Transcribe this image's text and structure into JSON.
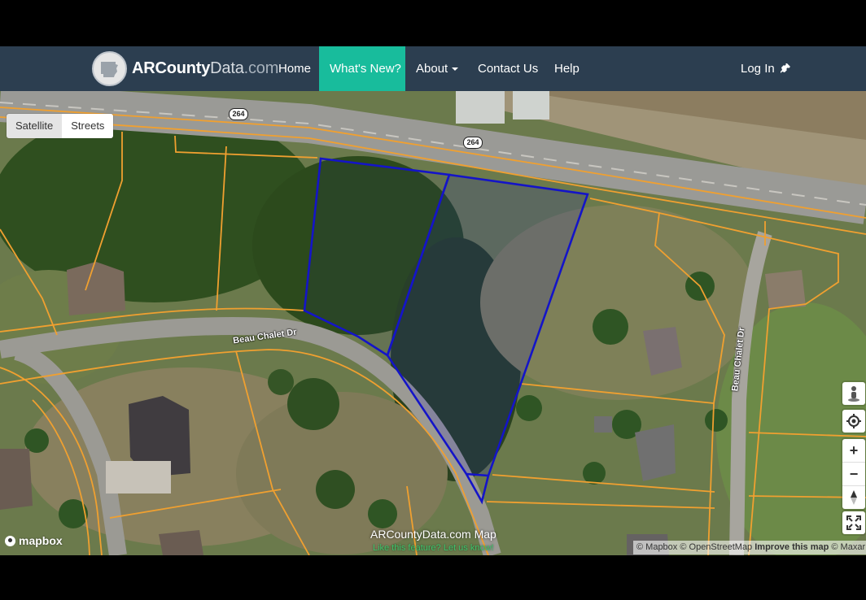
{
  "navbar": {
    "brand": {
      "part1": "ARCounty",
      "part2": "Data",
      "part3": ".com"
    },
    "items": [
      {
        "label": "Home"
      },
      {
        "label": "What's New?"
      },
      {
        "label": "About"
      },
      {
        "label": "Contact Us"
      },
      {
        "label": "Help"
      }
    ],
    "login_label": "Log In"
  },
  "map": {
    "style_toggle": {
      "selected": "Satellite",
      "other": "Streets"
    },
    "road_labels": {
      "highway": "264",
      "beau_chalet_1": "Beau Chalet Dr",
      "beau_chalet_2": "Beau Chalet Dr"
    },
    "caption_title": "ARCountyData.com Map",
    "caption_link": "Like this feature? Let us know!",
    "attribution": {
      "mapbox": "© Mapbox",
      "osm": "© OpenStreetMap",
      "improve": "Improve this map",
      "maxar": "© Maxar"
    },
    "mapbox_logo": "mapbox",
    "controls": [
      "pegman-icon",
      "locate-icon",
      "zoom-in",
      "zoom-out",
      "compass",
      "fullscreen-icon"
    ]
  },
  "colors": {
    "navbar": "#2c3e50",
    "active": "#18bc9c",
    "parcel_line": "#f0a030",
    "selected_parcel": "#1414c8"
  }
}
